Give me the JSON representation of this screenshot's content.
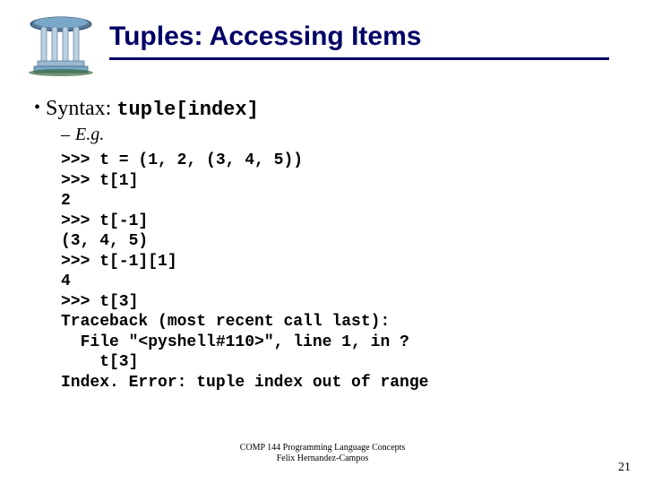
{
  "title": "Tuples: Accessing Items",
  "bullet1": {
    "prefix": "Syntax: ",
    "code": "tuple[index]"
  },
  "bullet2": "E.g.",
  "code_lines": ">>> t = (1, 2, (3, 4, 5))\n>>> t[1]\n2\n>>> t[-1]\n(3, 4, 5)\n>>> t[-1][1]\n4\n>>> t[3]\nTraceback (most recent call last):\n  File \"<pyshell#110>\", line 1, in ?\n    t[3]\nIndex. Error: tuple index out of range",
  "footer": {
    "line1": "COMP 144 Programming Language Concepts",
    "line2": "Felix Hernandez-Campos"
  },
  "page_number": "21"
}
